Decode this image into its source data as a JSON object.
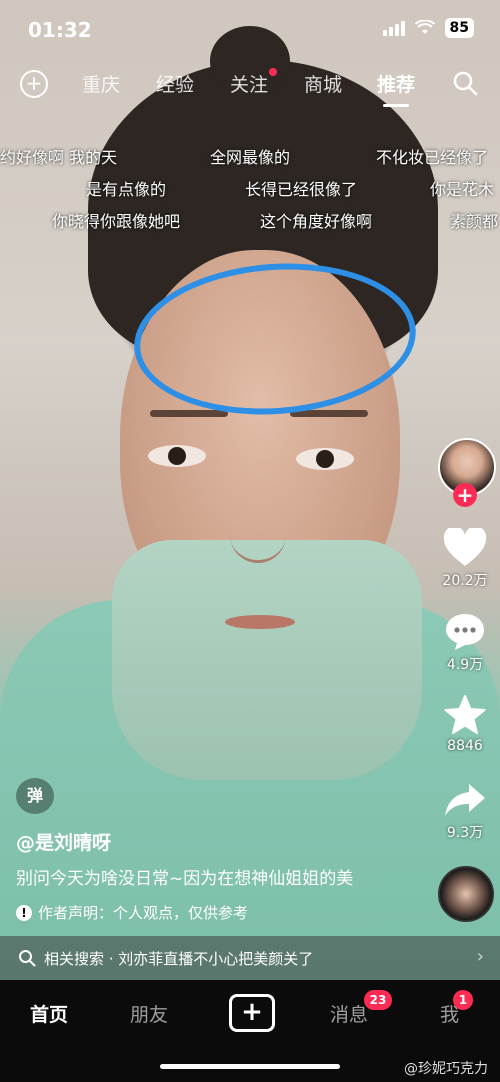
{
  "status": {
    "time": "01:32",
    "battery": "85"
  },
  "topnav": {
    "tabs": [
      {
        "label": "重庆"
      },
      {
        "label": "经验"
      },
      {
        "label": "关注"
      },
      {
        "label": "商城"
      },
      {
        "label": "推荐"
      }
    ],
    "active": "推荐"
  },
  "danmaku": [
    "约好像啊 我的天",
    "全网最像的",
    "不化妆已经像了",
    "是有点像的",
    "长得已经很像了",
    "你是花木",
    "你晓得你跟像她吧",
    "这个角度好像啊",
    "素颜都"
  ],
  "rail": {
    "likes": "20.2万",
    "comments": "4.9万",
    "favorites": "8846",
    "shares": "9.3万"
  },
  "video": {
    "danmu_toggle": "弹",
    "author": "@是刘晴呀",
    "caption": "别问今天为啥没日常~因为在想神仙姐姐的美",
    "disclaimer": "作者声明：个人观点，仅供参考"
  },
  "related_search": {
    "label": "相关搜索 · 刘亦菲直播不小心把美颜关了"
  },
  "tabbar": {
    "home": "首页",
    "friends": "朋友",
    "messages": "消息",
    "messages_badge": "23",
    "me": "我",
    "me_badge": "1"
  },
  "watermark": "@珍妮巧克力",
  "colors": {
    "accent_red": "#fe2c55",
    "annotation_blue": "#2d8fe6"
  }
}
